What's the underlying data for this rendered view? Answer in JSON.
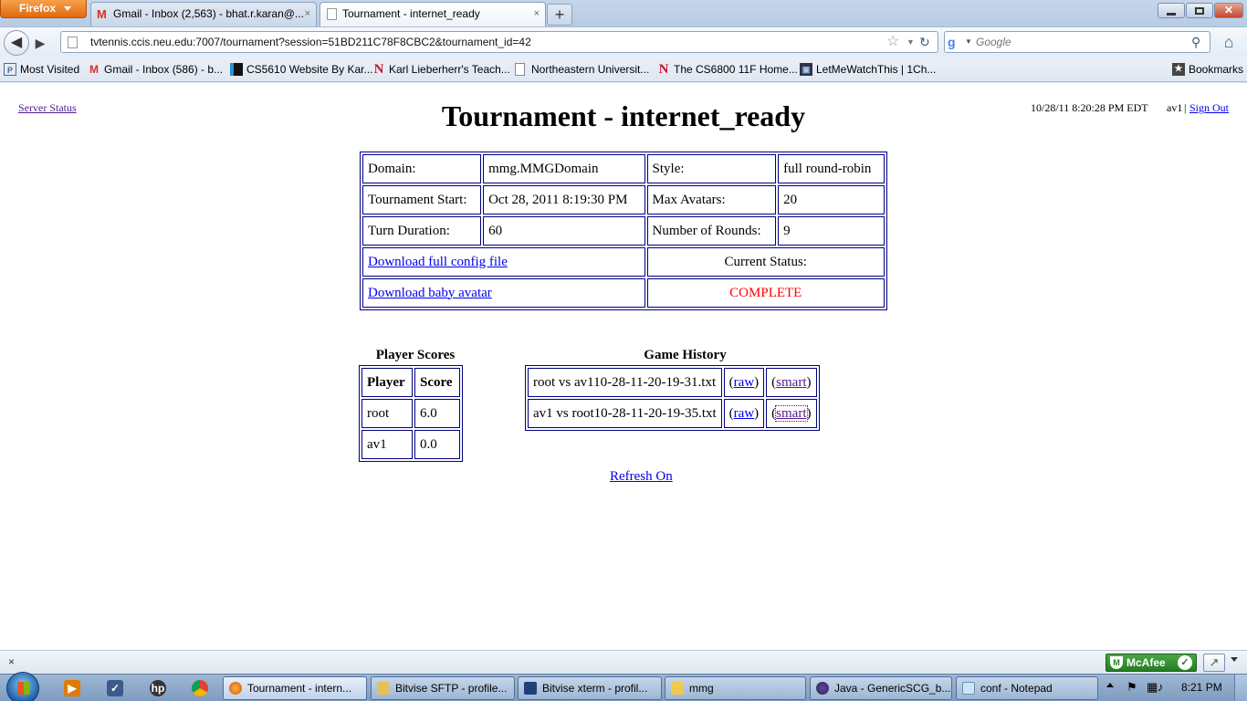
{
  "browser": {
    "app_button": "Firefox",
    "tabs": [
      {
        "label": "Gmail - Inbox (2,563) - bhat.r.karan@...",
        "close": "×"
      },
      {
        "label": "Tournament - internet_ready",
        "close": "×"
      }
    ],
    "new_tab": "+",
    "url": "tvtennis.ccis.neu.edu:7007/tournament?session=51BD211C78F8CBC2&tournament_id=42",
    "search_placeholder": "Google",
    "bookmarks": [
      "Most Visited",
      "Gmail - Inbox (586) - b...",
      "CS5610 Website By Kar...",
      "Karl Lieberherr's Teach...",
      "Northeastern Universit...",
      "The CS6800 11F Home...",
      "LetMeWatchThis | 1Ch...",
      "Bookmarks"
    ]
  },
  "page": {
    "server_status": "Server Status",
    "datetime": "10/28/11 8:20:28 PM EDT",
    "user": "av1",
    "separator": "|",
    "sign_out": "Sign Out",
    "title": "Tournament - internet_ready",
    "info": {
      "domain_label": "Domain:",
      "domain_value": "mmg.MMGDomain",
      "style_label": "Style:",
      "style_value": "full round-robin",
      "start_label": "Tournament Start:",
      "start_value": "Oct 28, 2011 8:19:30 PM",
      "max_avatars_label": "Max Avatars:",
      "max_avatars_value": "20",
      "turn_label": "Turn Duration:",
      "turn_value": "60",
      "rounds_label": "Number of Rounds:",
      "rounds_value": "9",
      "download_config": "Download full config file",
      "status_label": "Current Status:",
      "download_avatar": "Download baby avatar",
      "status_value": "COMPLETE",
      "status_color": "#ff0000"
    },
    "scores": {
      "title": "Player Scores",
      "headers": [
        "Player",
        "Score"
      ],
      "rows": [
        {
          "player": "root",
          "score": "6.0"
        },
        {
          "player": "av1",
          "score": "0.0"
        }
      ]
    },
    "history": {
      "title": "Game History",
      "rows": [
        {
          "game": "root vs av110-28-11-20-19-31.txt",
          "raw": "raw",
          "smart": "smart"
        },
        {
          "game": "av1 vs root10-28-11-20-19-35.txt",
          "raw": "raw",
          "smart": "smart"
        }
      ],
      "paren_open": "(",
      "paren_close": ")"
    },
    "refresh": "Refresh On"
  },
  "statusbar": {
    "close": "×",
    "mcafee": "McAfee"
  },
  "taskbar": {
    "tasks": [
      "Tournament - intern...",
      "Bitvise SFTP - profile...",
      "Bitvise xterm - profil...",
      "mmg",
      "Java - GenericSCG_b...",
      "conf - Notepad"
    ],
    "clock": "8:21 PM"
  }
}
